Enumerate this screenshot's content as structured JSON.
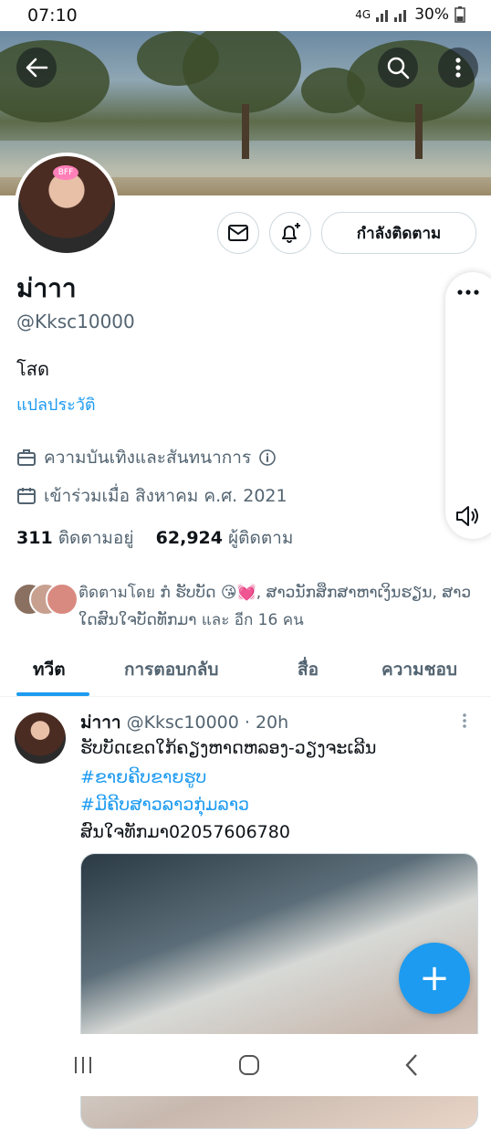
{
  "status_bar": {
    "time": "07:10",
    "battery": "30%",
    "network": "4G"
  },
  "profile": {
    "name": "ม่าาา",
    "handle": "@Kksc10000",
    "bio": "โสด",
    "translate_bio": "แปลประวัติ",
    "category": "ความบันเทิงและสันทนาการ",
    "joined": "เข้าร่วมเมื่อ สิงหาคม ค.ศ. 2021",
    "following_count": "311",
    "following_label": "ติดตามอยู่",
    "followers_count": "62,924",
    "followers_label": "ผู้ติดตาม",
    "followed_by": "ติดตามโดย ກໍ ຮັບບັດ 😘💓, ສາວນັກສຶກສາຫາເງິນຮຽນ, ສາວໃດສົນໃຈບັດທັກມາ และ อีก 16 คน",
    "follow_button": "กำลังติดตาม"
  },
  "tabs": [
    "ทวีต",
    "การตอบกลับ",
    "สื่อ",
    "ความชอบ"
  ],
  "tweet": {
    "name": "ม่าาา",
    "handle": "@Kksc10000",
    "time": "· 20h",
    "line1": "ຮັບບັດເຂດໃກ້ຄຽງຫາດຫລອງ-ວຽງຈະເລີນ",
    "tag1": "#ຂາຍຄີບຂາຍຮູບ",
    "tag2": "#ມີຄີບສາວລາວກຸ່ມລາວ",
    "line2": "ສົນໃຈທັກມາ02057606780"
  },
  "fab_label": "+",
  "colors": {
    "accent": "#1d9bf0",
    "text": "#0f1419",
    "muted": "#536471"
  }
}
